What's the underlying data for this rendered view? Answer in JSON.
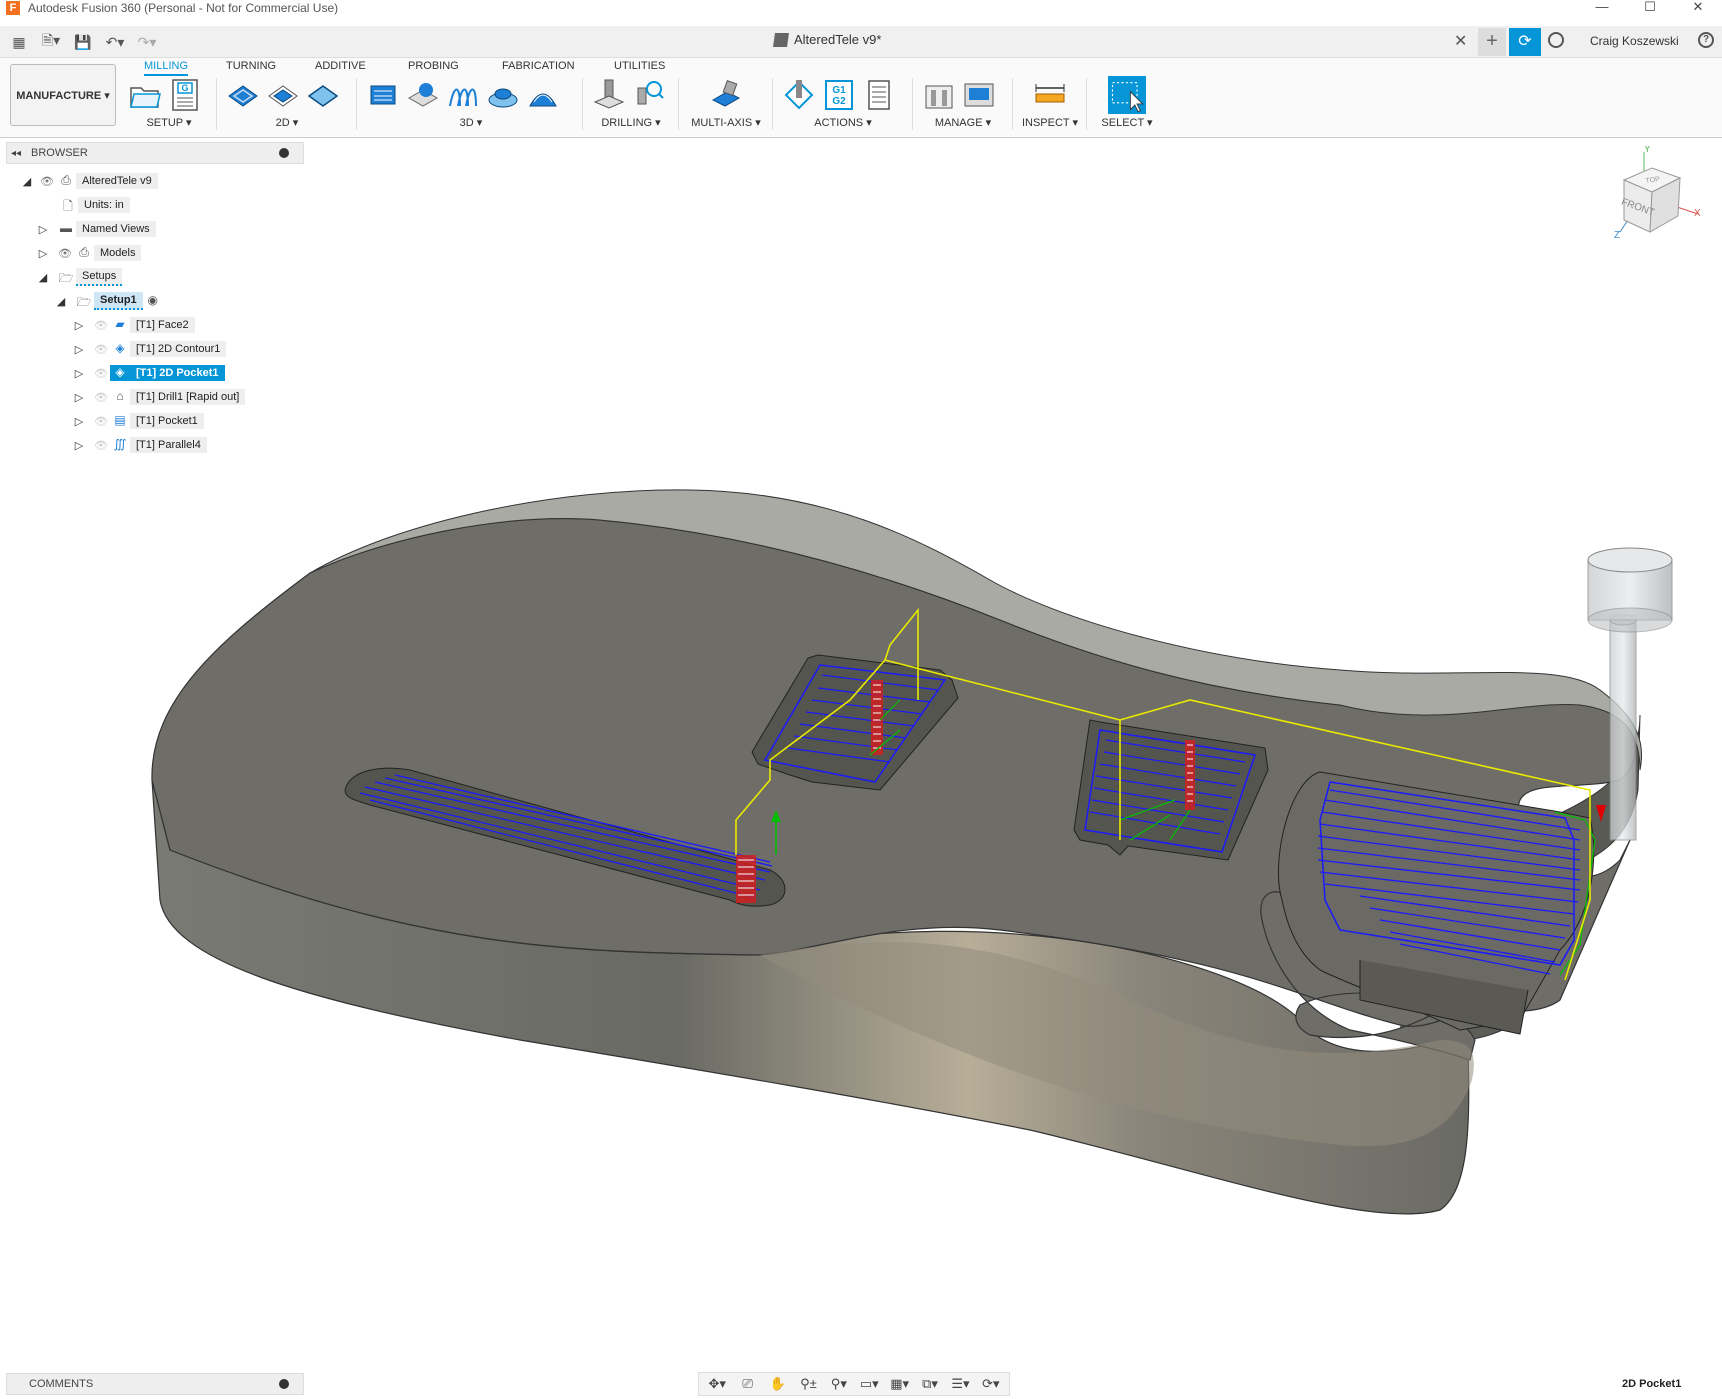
{
  "window": {
    "title": "Autodesk Fusion 360 (Personal - Not for Commercial Use)",
    "app_icon_letter": "F",
    "minimize": "—",
    "maximize": "☐",
    "close": "✕"
  },
  "tabbar": {
    "document_title": "AlteredTele v9*",
    "close_tab": "✕",
    "new_tab": "+",
    "user_name": "Craig Koszewski",
    "help": "?"
  },
  "ribbon": {
    "workspace": "MANUFACTURE ▾",
    "tabs": [
      "MILLING",
      "TURNING",
      "ADDITIVE",
      "PROBING",
      "FABRICATION",
      "UTILITIES"
    ],
    "active_tab": "MILLING",
    "groups": [
      {
        "label": "SETUP ▾"
      },
      {
        "label": "2D ▾"
      },
      {
        "label": "3D ▾"
      },
      {
        "label": "DRILLING ▾"
      },
      {
        "label": "MULTI-AXIS ▾"
      },
      {
        "label": "ACTIONS ▾"
      },
      {
        "label": "MANAGE ▾"
      },
      {
        "label": "INSPECT ▾"
      },
      {
        "label": "SELECT ▾"
      }
    ],
    "actions_g_code": [
      "G1",
      "G2"
    ],
    "accent_color": "#0696d7"
  },
  "browser": {
    "header": "BROWSER",
    "nodes": [
      {
        "label": "AlteredTele v9"
      },
      {
        "label": "Units: in"
      },
      {
        "label": "Named Views"
      },
      {
        "label": "Models"
      },
      {
        "label": "Setups"
      },
      {
        "label": "Setup1"
      },
      {
        "label": "[T1] Face2"
      },
      {
        "label": "[T1] 2D Contour1"
      },
      {
        "label": "[T1] 2D Pocket1"
      },
      {
        "label": "[T1] Drill1 [Rapid out]"
      },
      {
        "label": "[T1] Pocket1"
      },
      {
        "label": "[T1] Parallel4"
      }
    ]
  },
  "viewcube": {
    "top": "TOP",
    "front": "FRONT",
    "axis_x": "X",
    "axis_y": "Y",
    "axis_z": "Z"
  },
  "comments": {
    "label": "COMMENTS"
  },
  "status": {
    "selected_operation": "2D Pocket1"
  },
  "colors": {
    "toolpath": "#1a1aff",
    "rapid": "#ffff00",
    "plunge": "#ff0000",
    "lead": "#00cc00",
    "body": "#6f6e68"
  }
}
